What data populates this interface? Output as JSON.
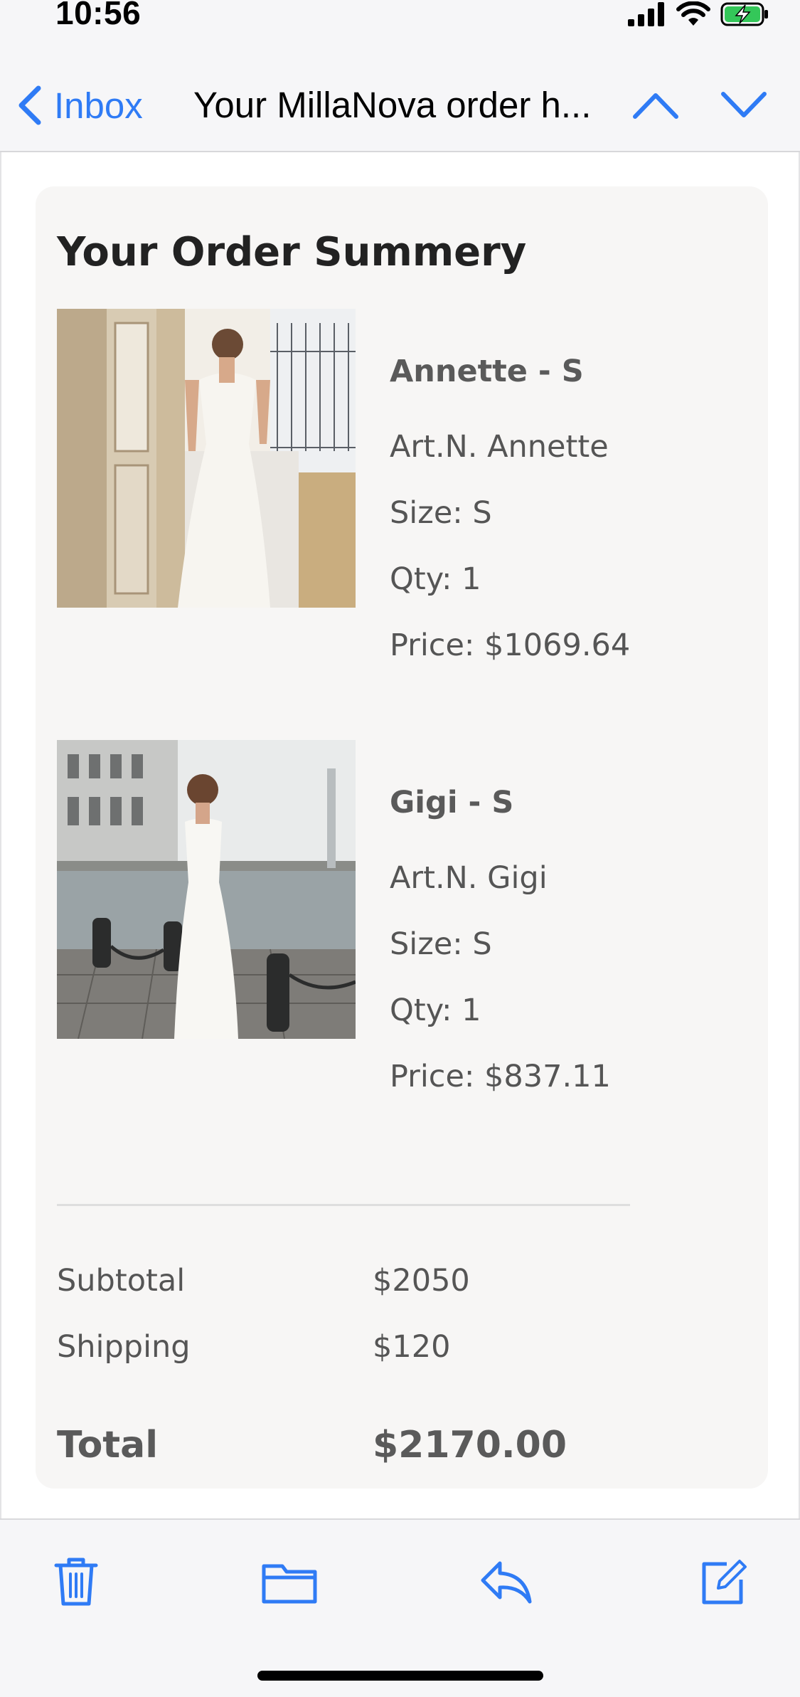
{
  "status_bar": {
    "time": "10:56"
  },
  "navbar": {
    "back_label": "Inbox",
    "title": "Your MillaNova order h...",
    "accent_color": "#2f7bf5"
  },
  "summary": {
    "title": "Your Order Summery",
    "items": [
      {
        "name": "Annette - S",
        "article": "Art.N. Annette",
        "size": "Size: S",
        "qty": "Qty: 1",
        "price": "Price: $1069.64"
      },
      {
        "name": "Gigi - S",
        "article": "Art.N. Gigi",
        "size": "Size: S",
        "qty": "Qty: 1",
        "price": "Price: $837.11"
      }
    ],
    "subtotal_label": "Subtotal",
    "subtotal_value": "$2050",
    "shipping_label": "Shipping",
    "shipping_value": "$120",
    "total_label": "Total",
    "total_value": "$2170.00"
  },
  "toolbar": {
    "icons": [
      "trash-icon",
      "folder-icon",
      "reply-icon",
      "compose-icon"
    ]
  }
}
